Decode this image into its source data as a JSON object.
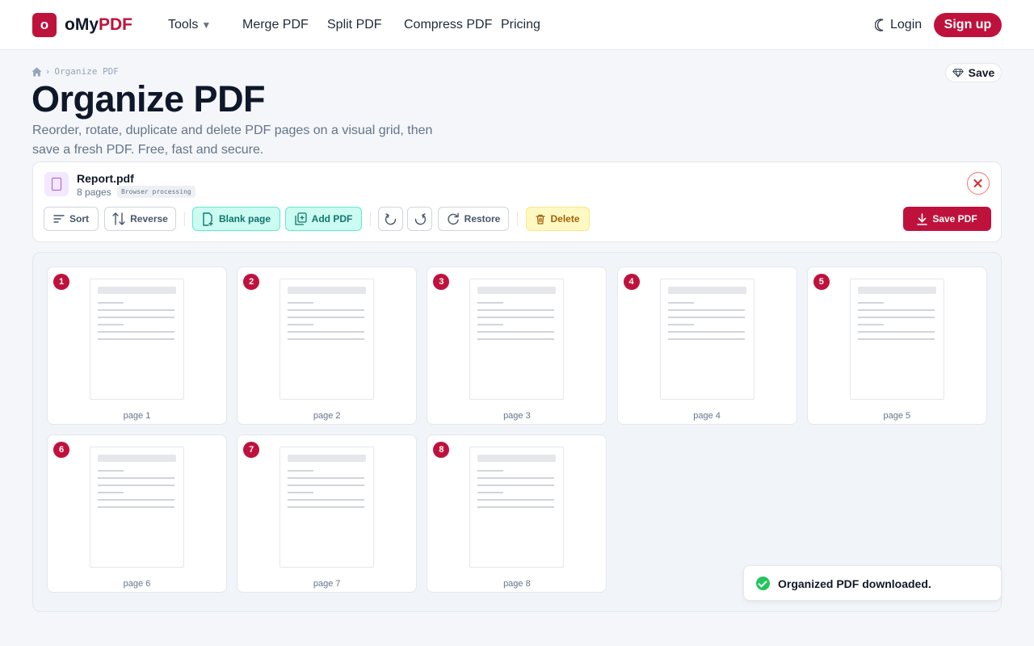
{
  "header": {
    "logo_letter": "o",
    "brand_prefix": "oMy",
    "brand_accent": "PDF",
    "nav": [
      {
        "label": "Tools",
        "dropdown": true
      },
      {
        "label": "Merge PDF"
      },
      {
        "label": "Split PDF"
      },
      {
        "label": "Compress PDF"
      },
      {
        "label": "Pricing"
      }
    ],
    "login_label": "Login",
    "signup_label": "Sign up"
  },
  "breadcrumb": {
    "current": "Organize PDF"
  },
  "save_pill_label": "Save",
  "hero": {
    "title": "Organize PDF",
    "subtitle": "Reorder, rotate, duplicate and delete PDF pages on a visual grid, then save a fresh PDF. Free, fast and secure."
  },
  "file": {
    "name": "Report.pdf",
    "pages_text": "8 pages",
    "badge": "Browser processing"
  },
  "toolbar": {
    "sort": "Sort",
    "reverse": "Reverse",
    "blank_page": "Blank page",
    "add_pdf": "Add PDF",
    "restore": "Restore",
    "delete": "Delete",
    "save_pdf": "Save PDF"
  },
  "pages": [
    {
      "num": "1",
      "label": "page 1"
    },
    {
      "num": "2",
      "label": "page 2"
    },
    {
      "num": "3",
      "label": "page 3"
    },
    {
      "num": "4",
      "label": "page 4"
    },
    {
      "num": "5",
      "label": "page 5"
    },
    {
      "num": "6",
      "label": "page 6"
    },
    {
      "num": "7",
      "label": "page 7"
    },
    {
      "num": "8",
      "label": "page 8"
    }
  ],
  "toast": {
    "message": "Organized PDF downloaded."
  },
  "colors": {
    "brand": "#be123c",
    "teal_bg": "#ccfbf1",
    "teal_text": "#0f766e",
    "amber_bg": "#fef9c3",
    "amber_text": "#a16207",
    "success": "#22c55e"
  },
  "icons": [
    "home-icon",
    "chevron-right-icon",
    "chevron-down-icon",
    "moon-icon",
    "diamond-icon",
    "file-icon",
    "close-icon",
    "sort-icon",
    "reverse-icon",
    "blank-page-icon",
    "add-pdf-icon",
    "rotate-left-icon",
    "rotate-right-icon",
    "restore-icon",
    "trash-icon",
    "download-icon",
    "check-circle-icon"
  ]
}
